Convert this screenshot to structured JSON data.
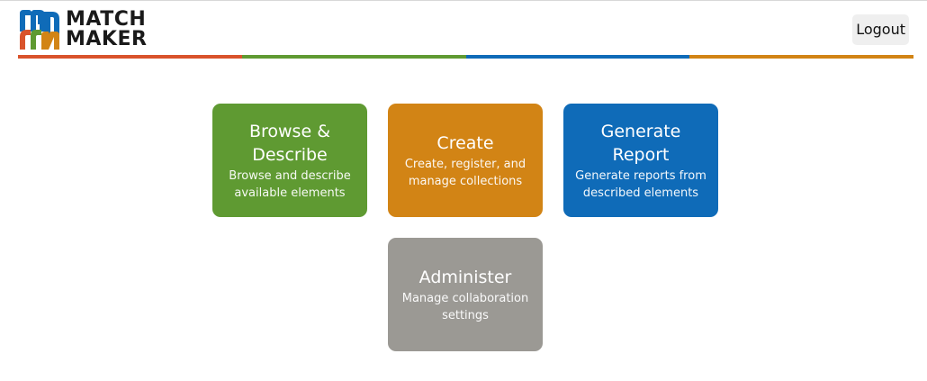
{
  "header": {
    "logo": {
      "line1": "MATCH",
      "line2": "MAKER"
    },
    "logout_label": "Logout"
  },
  "colors": {
    "green": "#5f9a32",
    "orange": "#d28415",
    "blue": "#0f6bb8",
    "gray": "#9b9994",
    "red_orange": "#d9532b"
  },
  "tiles": [
    {
      "title": "Browse & Describe",
      "description": "Browse and describe available elements",
      "color": "#5f9a32"
    },
    {
      "title": "Create",
      "description": "Create, register, and manage collections",
      "color": "#d28415"
    },
    {
      "title": "Generate Report",
      "description": "Generate reports from described elements",
      "color": "#0f6bb8"
    },
    {
      "title": "Administer",
      "description": "Manage collaboration settings",
      "color": "#9b9994"
    }
  ]
}
